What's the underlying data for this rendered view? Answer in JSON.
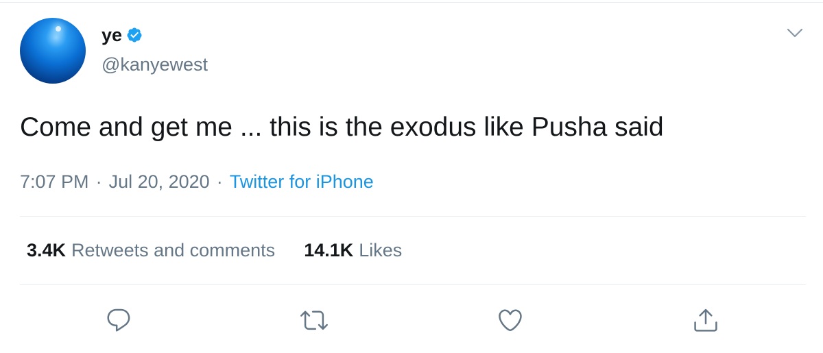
{
  "user": {
    "display_name": "ye",
    "handle": "@kanyewest",
    "verified_icon": "verified-badge-icon",
    "avatar_icon": "blue-sphere-avatar"
  },
  "menu": {
    "icon": "chevron-down-icon"
  },
  "tweet": {
    "text": "Come and get me ... this is the exodus like Pusha said",
    "time": "7:07 PM",
    "separator": "·",
    "date": "Jul 20, 2020",
    "source": "Twitter for iPhone"
  },
  "stats": {
    "retweets_count": "3.4K",
    "retweets_label": "Retweets and comments",
    "likes_count": "14.1K",
    "likes_label": "Likes"
  },
  "actions": [
    {
      "icon": "reply-icon"
    },
    {
      "icon": "retweet-icon"
    },
    {
      "icon": "like-heart-icon"
    },
    {
      "icon": "share-icon"
    }
  ],
  "colors": {
    "text_primary": "#14171a",
    "text_secondary": "#657786",
    "link": "#1b95e0",
    "verified": "#1da1f2",
    "border": "#e6ecf0"
  }
}
